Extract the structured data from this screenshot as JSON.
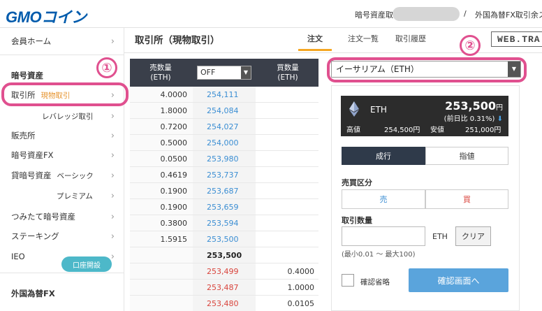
{
  "header": {
    "logo_latin": "GMO",
    "logo_kana": "コイン",
    "assets_label": "暗号資産取",
    "separator": "/",
    "fx_label": "外国為替FX取引余ス"
  },
  "sidebar": {
    "member_home": "会員ホーム",
    "section_crypto": "暗号資産",
    "exchange": "取引所",
    "exchange_sub": "現物取引",
    "leverage": "レバレッジ取引",
    "sales": "販売所",
    "crypto_fx": "暗号資産FX",
    "lending": "貸暗号資産",
    "lending_basic": "ベーシック",
    "lending_premium": "プレミアム",
    "tsumitate": "つみたて暗号資産",
    "staking": "ステーキング",
    "ieo": "IEO",
    "section_fx": "外国為替FX",
    "open_account": "口座開設",
    "chevron": "›"
  },
  "annotations": {
    "one": "①",
    "two": "②"
  },
  "main": {
    "title": "取引所（現物取引）",
    "tabs": [
      "注文",
      "注文一覧",
      "取引履歴"
    ],
    "webtrade": "WEB.TRA"
  },
  "orderbook": {
    "sell_qty_header_1": "売数量",
    "sell_qty_header_2": "(ETH)",
    "buy_qty_header_1": "買数量",
    "buy_qty_header_2": "(ETH)",
    "group_select": "OFF",
    "asks": [
      {
        "qty": "4.0000",
        "price": "254,111"
      },
      {
        "qty": "1.8000",
        "price": "254,084"
      },
      {
        "qty": "0.7200",
        "price": "254,027"
      },
      {
        "qty": "0.5000",
        "price": "254,000"
      },
      {
        "qty": "0.0500",
        "price": "253,980"
      },
      {
        "qty": "0.4619",
        "price": "253,737"
      },
      {
        "qty": "0.1900",
        "price": "253,687"
      },
      {
        "qty": "0.1900",
        "price": "253,659"
      },
      {
        "qty": "0.3800",
        "price": "253,594"
      },
      {
        "qty": "1.5915",
        "price": "253,500"
      }
    ],
    "mid_price": "253,500",
    "bids": [
      {
        "price": "253,499",
        "qty": "0.4000"
      },
      {
        "price": "253,487",
        "qty": "1.0000"
      },
      {
        "price": "253,480",
        "qty": "0.0105"
      }
    ]
  },
  "order": {
    "symbol": "イーサリアム（ETH）",
    "ticker_symbol": "ETH",
    "price": "253,500",
    "price_unit": "円",
    "change": "(前日比 0.31%)",
    "change_arrow": "⬇",
    "high_label": "高値",
    "high_value": "254,500円",
    "low_label": "安値",
    "low_value": "251,000円",
    "type_market": "成行",
    "type_limit": "指値",
    "side_label": "売買区分",
    "sell": "売",
    "buy": "買",
    "qty_label": "取引数量",
    "qty_unit": "ETH",
    "clear": "クリア",
    "qty_hint": "(最小0.01 〜 最大100)",
    "skip_confirm": "確認省略",
    "confirm": "確認画面へ"
  },
  "colors": {
    "brand": "#005bac",
    "highlight": "#e0508f",
    "ask": "#3b8ed3",
    "bid": "#d9443c",
    "confirm": "#5aa4dc"
  }
}
